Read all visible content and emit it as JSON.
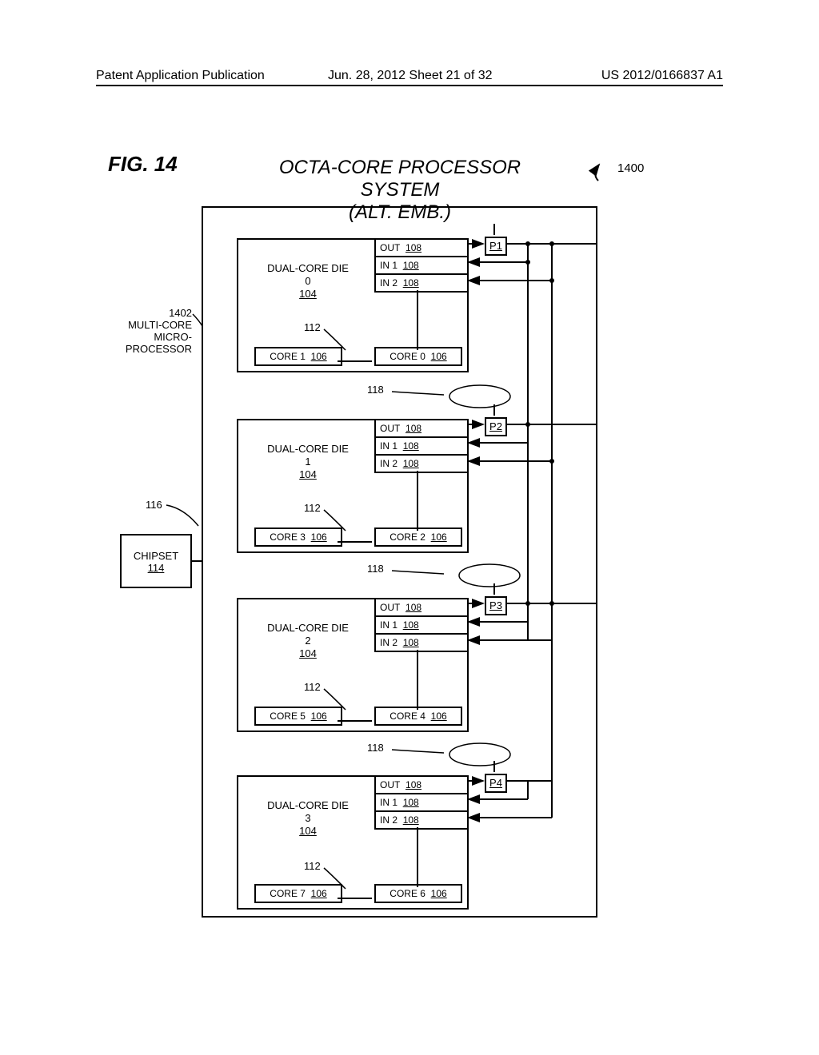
{
  "header": {
    "left": "Patent Application Publication",
    "center": "Jun. 28, 2012  Sheet 21 of 32",
    "right": "US 2012/0166837 A1"
  },
  "figure_label": "FIG. 14",
  "title_line1": "OCTA-CORE PROCESSOR SYSTEM",
  "title_line2": "(ALT. EMB.)",
  "ref_1400": "1400",
  "ref_1402_line1": "1402",
  "ref_1402_line2": "MULTI-CORE",
  "ref_1402_line3": "MICRO-",
  "ref_1402_line4": "PROCESSOR",
  "ref_116": "116",
  "ref_112": "112",
  "ref_118": "118",
  "chipset_label": "CHIPSET",
  "chipset_num": "114",
  "io": {
    "out": "OUT",
    "in1": "IN 1",
    "in2": "IN 2",
    "num": "108"
  },
  "pads": {
    "p1": "P1",
    "p2": "P2",
    "p3": "P3",
    "p4": "P4"
  },
  "dies": [
    {
      "label": "DUAL-CORE DIE 0",
      "num": "104",
      "core_left": "CORE 1",
      "core_right": "CORE 0",
      "core_num": "106"
    },
    {
      "label": "DUAL-CORE DIE 1",
      "num": "104",
      "core_left": "CORE 3",
      "core_right": "CORE 2",
      "core_num": "106"
    },
    {
      "label": "DUAL-CORE DIE 2",
      "num": "104",
      "core_left": "CORE 5",
      "core_right": "CORE 4",
      "core_num": "106"
    },
    {
      "label": "DUAL-CORE DIE 3",
      "num": "104",
      "core_left": "CORE 7",
      "core_right": "CORE 6",
      "core_num": "106"
    }
  ]
}
